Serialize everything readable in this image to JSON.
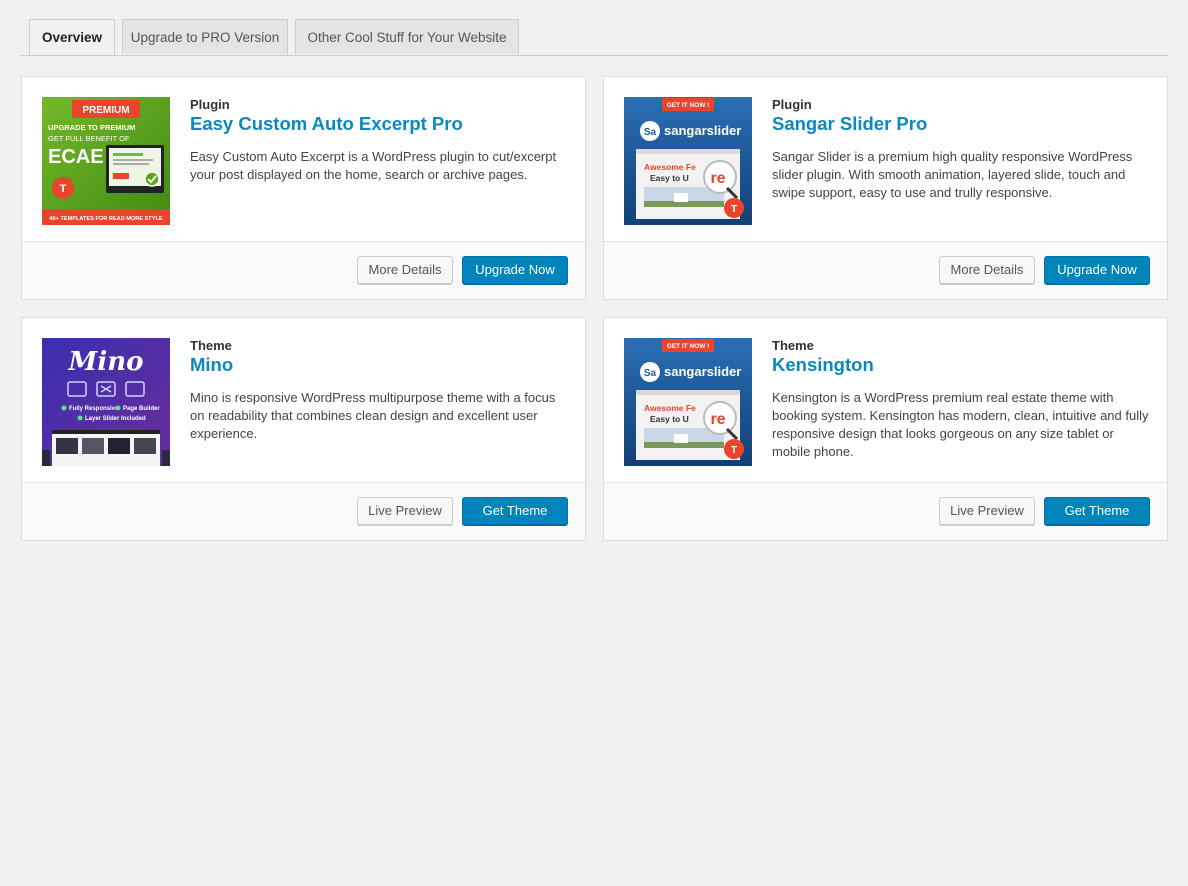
{
  "tabs": [
    {
      "label": "Overview",
      "active": true
    },
    {
      "label": "Upgrade to PRO Version",
      "active": false
    },
    {
      "label": "Other Cool Stuff for Your Website",
      "active": false
    }
  ],
  "cards": [
    {
      "kind": "Plugin",
      "name": "Easy Custom Auto Excerpt Pro",
      "description": "Easy Custom Auto Excerpt is a WordPress plugin to cut/excerpt your post displayed on the home, search or archive pages.",
      "secondary_label": "More Details",
      "primary_label": "Upgrade Now",
      "thumb": {
        "badge": "PREMIUM",
        "line1": "UPGRADE TO PREMIUM",
        "line2": "GET FULL BENEFIT OF",
        "title": "ECAE",
        "footer": "40+ TEMPLATES FOR READ MORE STYLE",
        "logo": "T"
      }
    },
    {
      "kind": "Plugin",
      "name": "Sangar Slider Pro",
      "description": "Sangar Slider is a premium high quality responsive WordPress slider plugin. With smooth animation, layered slide, touch and swipe support, easy to use and trully responsive.",
      "secondary_label": "More Details",
      "primary_label": "Upgrade Now",
      "thumb": {
        "ribbon": "GET IT NOW !",
        "logo_mark": "Sa",
        "brand": "sangarslider",
        "headline1": "Awesome Fe",
        "headline2": "Easy to U",
        "magnifier": "re",
        "logo": "T"
      }
    },
    {
      "kind": "Theme",
      "name": "Mino",
      "description": "Mino is responsive WordPress multipurpose theme with a focus on readability that combines clean design and excellent user experience.",
      "secondary_label": "Live Preview",
      "primary_label": "Get Theme",
      "thumb": {
        "title": "Mino",
        "feature1": "Fully Responsive",
        "feature2": "Page Builder",
        "feature3": "Layer Slider Included"
      }
    },
    {
      "kind": "Theme",
      "name": "Kensington",
      "description": "Kensington is a WordPress premium real estate theme with booking system. Kensington has modern, clean, intuitive and fully responsive design that looks gorgeous on any size tablet or mobile phone.",
      "secondary_label": "Live Preview",
      "primary_label": "Get Theme",
      "thumb": {
        "ribbon": "GET IT NOW !",
        "logo_mark": "Sa",
        "brand": "sangarslider",
        "headline1": "Awesome Fe",
        "headline2": "Easy to U",
        "magnifier": "re",
        "logo": "T"
      }
    }
  ],
  "colors": {
    "link": "#0a88c0",
    "primary_button": "#0085ba",
    "ecae_green": "#5fa61c",
    "ecae_red": "#e8452c",
    "sangar_blue": "#1e5a9a",
    "mino_purple": "#4a2a9a"
  }
}
